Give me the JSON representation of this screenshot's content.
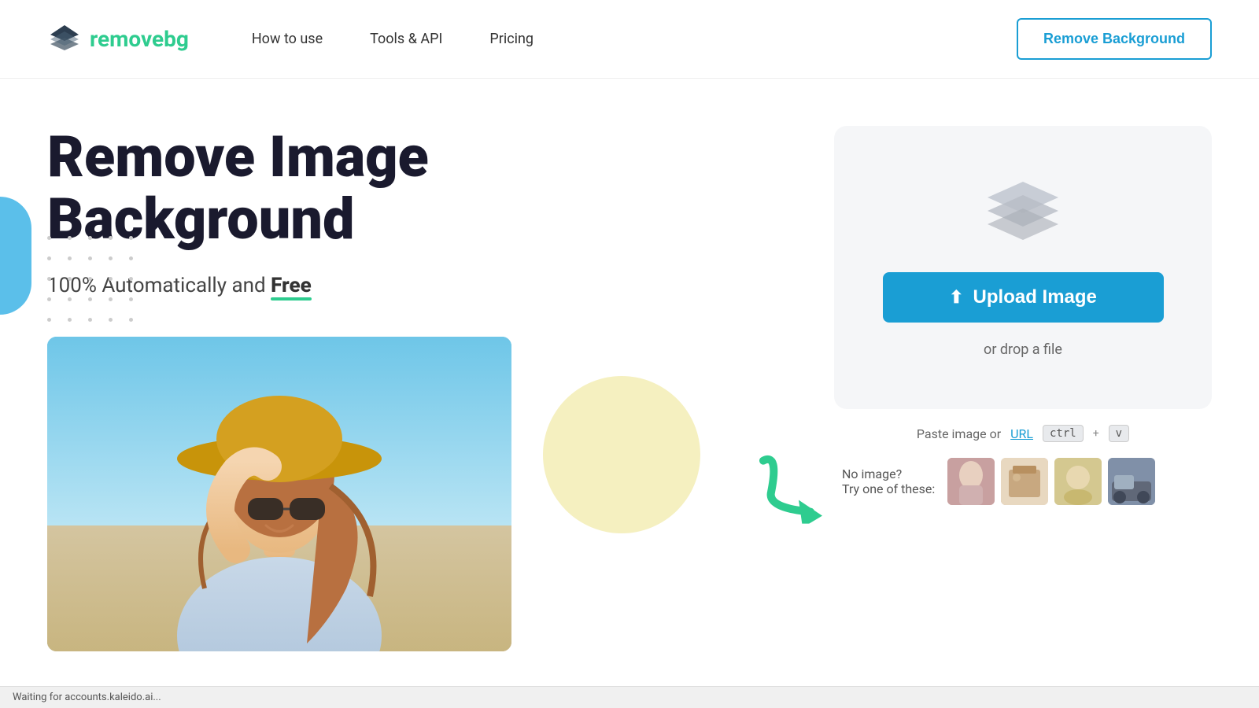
{
  "nav": {
    "logo_text_remove": "remove",
    "logo_text_bg": "bg",
    "links": [
      {
        "label": "How to use",
        "id": "how-to-use"
      },
      {
        "label": "Tools & API",
        "id": "tools-api"
      },
      {
        "label": "Pricing",
        "id": "pricing"
      }
    ],
    "cta_label": "Remove Background"
  },
  "hero": {
    "title_line1": "Remove Image",
    "title_line2": "Background",
    "subtitle_prefix": "100% Automatically and ",
    "subtitle_strong": "Free"
  },
  "upload": {
    "btn_label": "Upload Image",
    "drop_label": "or drop a file",
    "paste_label": "Paste image or ",
    "paste_url_label": "URL",
    "kbd_ctrl": "ctrl",
    "kbd_plus": "+",
    "kbd_v": "v",
    "no_image_label": "No image?",
    "try_label": "Try one of these:"
  },
  "status": {
    "text": "Waiting for accounts.kaleido.ai..."
  },
  "icons": {
    "upload": "⬆",
    "layers": "layers-icon"
  }
}
